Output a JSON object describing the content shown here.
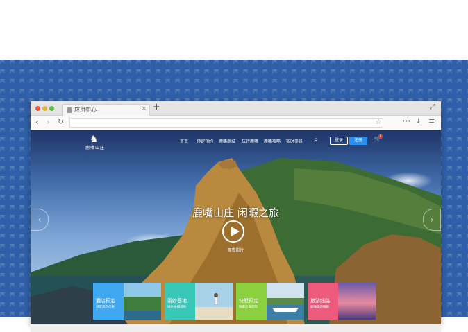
{
  "browser": {
    "tab_title": "应用中心",
    "tab_close": "×",
    "new_tab": "+",
    "url": ""
  },
  "site": {
    "logo_text": "鹿嘴山庄",
    "nav": [
      "首页",
      "预定预约",
      "鹿嘴商城",
      "玩转鹿嘴",
      "鹿嘴攻略",
      "实时美景"
    ],
    "login": "登录",
    "register": "注册",
    "cart_count": "0",
    "hero_title": "鹿嘴山庄 闲暇之旅",
    "play_caption": "观看影片"
  },
  "cards": [
    {
      "title": "酒店预定",
      "sub": "预定酒店优惠",
      "color": "#3ea9f0"
    },
    {
      "title": "婚纱基地",
      "sub": "婚纱拍摄基地",
      "color": "#38c8b8"
    },
    {
      "title": "快艇预定",
      "sub": "快艇出海游玩",
      "color": "#8bd03e"
    },
    {
      "title": "旅游线路",
      "sub": "鹿嘴旅游线路",
      "color": "#ee5a7c"
    }
  ],
  "colors": {
    "background": "#2f5fa8",
    "register_button": "#2b8ff2"
  }
}
